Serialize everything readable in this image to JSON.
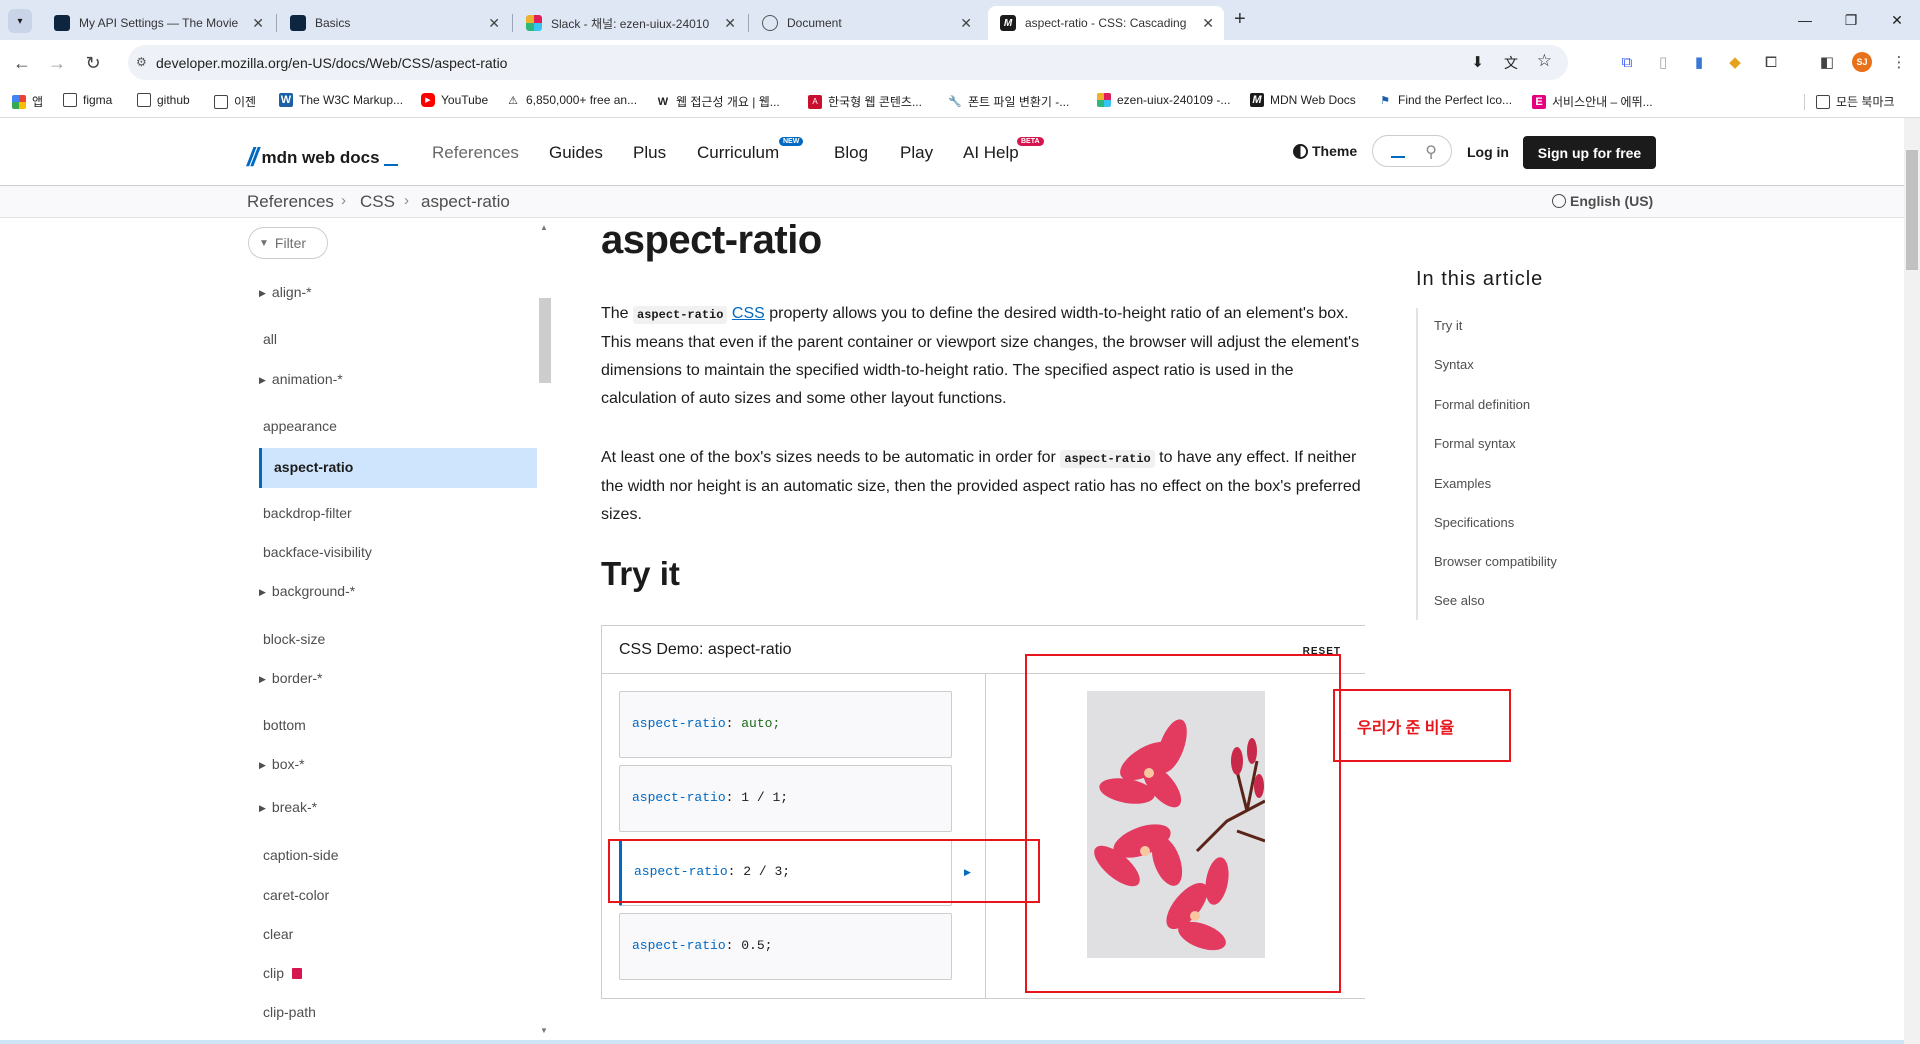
{
  "browser": {
    "tabs": [
      {
        "title": "My API Settings — The Movie",
        "icon": "tmdb-icon",
        "active": false
      },
      {
        "title": "Basics",
        "icon": "tmdb-icon",
        "active": false
      },
      {
        "title": "Slack - 채널: ezen-uiux-24010",
        "icon": "slack-icon",
        "active": false
      },
      {
        "title": "Document",
        "icon": "globe-icon",
        "active": false
      },
      {
        "title": "aspect-ratio - CSS: Cascading",
        "icon": "mdn-icon",
        "active": true
      }
    ],
    "url": "developer.mozilla.org/en-US/docs/Web/CSS/aspect-ratio",
    "bookmarks": [
      {
        "label": "앱",
        "icon": "apps-grid-icon"
      },
      {
        "label": "figma",
        "icon": "folder-icon"
      },
      {
        "label": "github",
        "icon": "folder-icon"
      },
      {
        "label": "이젠",
        "icon": "folder-icon"
      },
      {
        "label": "The W3C Markup...",
        "icon": "w3c-icon"
      },
      {
        "label": "YouTube",
        "icon": "youtube-icon"
      },
      {
        "label": "6,850,000+ free an...",
        "icon": "flaticon-icon"
      },
      {
        "label": "웹 접근성 개요 | 웹...",
        "icon": "w-icon"
      },
      {
        "label": "한국형 웹 콘텐츠...",
        "icon": "pdf-icon"
      },
      {
        "label": "폰트 파일 변환기 -...",
        "icon": "wrench-icon"
      },
      {
        "label": "ezen-uiux-240109 -...",
        "icon": "slack-icon"
      },
      {
        "label": "MDN Web Docs",
        "icon": "mdn-icon"
      },
      {
        "label": "Find the Perfect Ico...",
        "icon": "flag-icon"
      },
      {
        "label": "서비스안내 – 에뛰...",
        "icon": "e-icon"
      }
    ],
    "all_bookmarks": "모든 북마크",
    "profile_initials": "SJ"
  },
  "mdn": {
    "logo": "mdn web docs",
    "nav": [
      "References",
      "Guides",
      "Plus",
      "Curriculum",
      "Blog",
      "Play",
      "AI Help"
    ],
    "curriculum_badge": "NEW",
    "aihelp_badge": "BETA",
    "theme": "Theme",
    "login": "Log in",
    "signup": "Sign up for free",
    "breadcrumbs": [
      "References",
      "CSS",
      "aspect-ratio"
    ],
    "language": "English (US)"
  },
  "sidebar": {
    "filter_placeholder": "Filter",
    "items": [
      "align-*",
      "all",
      "animation-*",
      "appearance",
      "aspect-ratio",
      "backdrop-filter",
      "backface-visibility",
      "background-*",
      "block-size",
      "border-*",
      "bottom",
      "box-*",
      "break-*",
      "caption-side",
      "caret-color",
      "clear",
      "clip",
      "clip-path"
    ]
  },
  "article": {
    "title": "aspect-ratio",
    "p1_a": "The ",
    "p1_code": "aspect-ratio",
    "p1_link": "CSS",
    "p1_b": " property allows you to define the desired width-to-height ratio of an element's box. This means that even if the parent container or viewport size changes, the browser will adjust the element's dimensions to maintain the specified width-to-height ratio. The specified aspect ratio is used in the calculation of auto sizes and some other layout functions.",
    "p2_a": "At least one of the box's sizes needs to be automatic in order for ",
    "p2_code": "aspect-ratio",
    "p2_b": " to have any effect. If neither the width nor height is an automatic size, then the provided aspect ratio has no effect on the box's preferred sizes.",
    "try_it": "Try it"
  },
  "demo": {
    "title": "CSS Demo: aspect-ratio",
    "reset": "RESET",
    "choices": [
      {
        "prop": "aspect-ratio",
        "val": "auto;"
      },
      {
        "prop": "aspect-ratio",
        "val": "1 / 1;"
      },
      {
        "prop": "aspect-ratio",
        "val": "2 / 3;"
      },
      {
        "prop": "aspect-ratio",
        "val": "0.5;"
      }
    ],
    "selected_index": 2
  },
  "annotation": "우리가 준 비율",
  "toc": {
    "title": "In this article",
    "items": [
      "Try it",
      "Syntax",
      "Formal definition",
      "Formal syntax",
      "Examples",
      "Specifications",
      "Browser compatibility",
      "See also"
    ]
  }
}
